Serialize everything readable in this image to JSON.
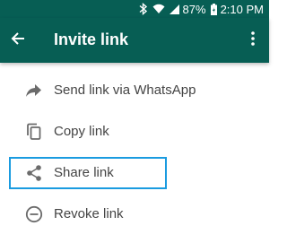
{
  "status_bar": {
    "battery_percent": "87%",
    "time": "2:10 PM",
    "icons": [
      "bluetooth-icon",
      "wifi-icon",
      "signal-icon",
      "battery-icon"
    ]
  },
  "app_bar": {
    "title": "Invite link",
    "back_icon": "arrow-left-icon",
    "menu_icon": "more-vertical-icon",
    "color": "#075e54"
  },
  "items": [
    {
      "label": "Send link via WhatsApp",
      "icon": "forward-arrow-icon"
    },
    {
      "label": "Copy link",
      "icon": "copy-icon"
    },
    {
      "label": "Share link",
      "icon": "share-icon"
    },
    {
      "label": "Revoke link",
      "icon": "remove-circle-icon"
    }
  ],
  "highlight_color": "#1a9be0"
}
